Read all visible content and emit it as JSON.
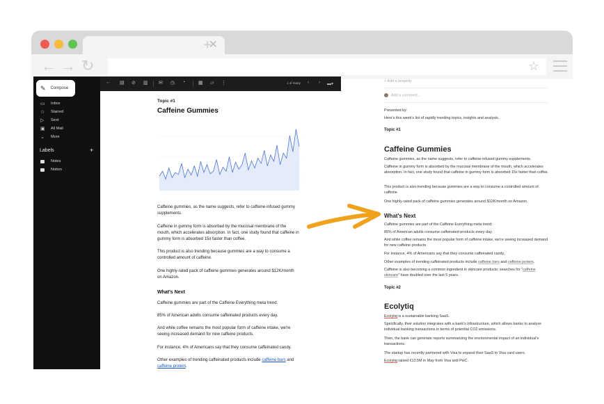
{
  "gmail": {
    "compose_label": "Compose",
    "nav": [
      "Inbox",
      "Starred",
      "Sent",
      "All Mail",
      "More"
    ],
    "labels_title": "Labels",
    "labels": [
      "Notes",
      "Notion"
    ],
    "pager": "1 of many"
  },
  "email": {
    "topic": "Topic #1",
    "title": "Caffeine Gummies",
    "p1": "Caffeine gummies, as the name suggests, refer to caffeine-infused gummy supplements.",
    "p2": "Caffeine in gummy form is absorbed by the mucosal membrane of the mouth, which accelerates absorption. In fact, one study found that caffeine in gummy form is absorbed 15x faster than coffee.",
    "p3": "This product is also trending because gummies are a way to consume a controlled amount of caffeine.",
    "p4": "One highly-rated pack of caffeine gummies generates around $12K/month on Amazon.",
    "whats_next": "What's Next",
    "p5": "Caffeine gummies are part of the Caffeine Everything meta trend.",
    "p6": "85% of American adults consume caffeinated products every day.",
    "p7": "And while coffee remains the most popular form of caffeine intake, we're seeing increased demand for new caffeine products.",
    "p8": "For instance, 4% of Americans say that they consume caffeinated candy.",
    "p9_pre": "Other examples of trending caffeinated products include ",
    "p9_link1": "caffeine bars",
    "p9_mid": " and ",
    "p9_link2": "caffeine protein",
    "p9_post": "."
  },
  "notion": {
    "add_property": "Add a property",
    "add_comment": "Add a comment...",
    "presented_by": "Presented by:",
    "intro": "Here's this week's list of rapidly trending topics, insights and analysis.",
    "topic1": "Topic #1",
    "title1": "Caffeine Gummies",
    "p1": "Caffeine gummies, as the name suggests, refer to caffeine-infused gummy supplements.",
    "p2": "Caffeine in gummy form is absorbed by the mucosal membrane of the mouth, which accelerates absorption. In fact, one study found that caffeine in gummy form is absorbed 15x faster than coffee.",
    "p3": "This product is also trending because gummies are a way to consume a controlled amount of caffeine.",
    "p4": "One highly-rated pack of caffeine gummies generates around $12K/month on Amazon.",
    "whats_next": "What's Next",
    "p5": "Caffeine gummies are part of the Caffeine Everything meta trend.",
    "p6": "85% of American adults consume caffeinated products every day.",
    "p7": "And while coffee remains the most popular form of caffeine intake, we're seeing increased demand for new caffeine products.",
    "p8": "For instance, 4% of Americans say that they consume caffeinated candy.",
    "p9_pre": "Other examples of trending caffeinated products include ",
    "p9_link1": "caffeine bars",
    "p9_mid": " and ",
    "p9_link2": "caffeine protein",
    "p9_post": ".",
    "p10_pre": "Caffeine is also becoming a common ingredient in skincare products; searches for \"",
    "p10_link": "caffeine skincare",
    "p10_post": "\" have doubled over the last 5 years.",
    "topic2": "Topic #2",
    "title2": "Ecolytiq",
    "e1_link": "Ecolytiq",
    "e1_post": " is a sustainable banking SaaS.",
    "e2": "Specifically, their solution integrates with a bank's infrastructure, which allows banks to analyze individual banking transactions in terms of potential CO2 emissions.",
    "e3": "Then, the bank can generate reports summarizing the environmental impact of an individual's transactions.",
    "e4": "The startup has recently partnered with Visa to expand their SaaS to Visa card users.",
    "e5_link": "Ecolytiq",
    "e5_post": " raised €13.5M in May from Visa and PwC."
  },
  "chart_data": {
    "type": "area",
    "values": [
      22,
      30,
      18,
      35,
      20,
      28,
      25,
      42,
      20,
      33,
      24,
      38,
      22,
      45,
      28,
      40,
      26,
      30,
      48,
      25,
      36,
      30,
      52,
      28,
      44,
      33,
      40,
      58,
      32,
      46,
      35,
      50,
      42,
      62,
      38,
      55,
      45,
      70,
      40,
      58,
      50,
      85,
      60,
      95,
      68
    ]
  },
  "colors": {
    "arrow": "#f0a21c",
    "line": "#4a74d8",
    "area": "#e4ecfb"
  }
}
